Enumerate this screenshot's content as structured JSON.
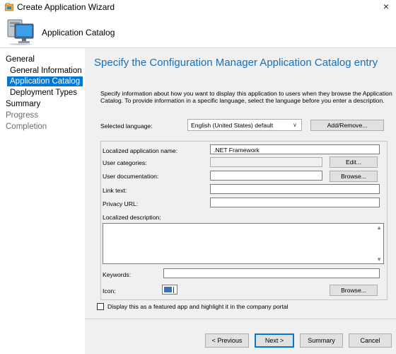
{
  "window": {
    "title": "Create Application Wizard",
    "close_glyph": "×"
  },
  "header": {
    "title": "Application Catalog"
  },
  "sidebar": {
    "items": [
      {
        "label": "General",
        "level": 1,
        "state": "normal"
      },
      {
        "label": "General Information",
        "level": 2,
        "state": "normal"
      },
      {
        "label": "Application Catalog",
        "level": 2,
        "state": "active"
      },
      {
        "label": "Deployment Types",
        "level": 2,
        "state": "normal"
      },
      {
        "label": "Summary",
        "level": 1,
        "state": "normal"
      },
      {
        "label": "Progress",
        "level": 1,
        "state": "disabled"
      },
      {
        "label": "Completion",
        "level": 1,
        "state": "disabled"
      }
    ]
  },
  "main": {
    "heading": "Specify the Configuration Manager Application Catalog entry",
    "description": "Specify information about how you want to display this application to users when they browse the Application Catalog. To provide information in a specific language, select the language before you enter a description.",
    "selected_language_label": "Selected language:",
    "selected_language_value": "English (United States) default",
    "add_remove_label": "Add/Remove...",
    "localized_name_label": "Localized application name:",
    "localized_name_value": ".NET Framework",
    "user_categories_label": "User categories:",
    "user_categories_value": "",
    "edit_label": "Edit...",
    "user_documentation_label": "User documentation:",
    "user_documentation_value": "",
    "browse_label": "Browse...",
    "link_text_label": "Link text:",
    "link_text_value": "",
    "privacy_url_label": "Privacy URL:",
    "privacy_url_value": "",
    "localized_description_label": "Localized description:",
    "localized_description_value": "",
    "keywords_label": "Keywords:",
    "keywords_value": "",
    "icon_label": "Icon:",
    "icon_browse_label": "Browse...",
    "featured_label": "Display this as a featured app and highlight it in the company portal",
    "featured_checked": false
  },
  "footer": {
    "previous_label": "< Previous",
    "next_label": "Next >",
    "summary_label": "Summary",
    "cancel_label": "Cancel"
  },
  "colors": {
    "accent": "#0078d7",
    "heading": "#1a6fb5",
    "content_bg": "#f0f0f0"
  }
}
